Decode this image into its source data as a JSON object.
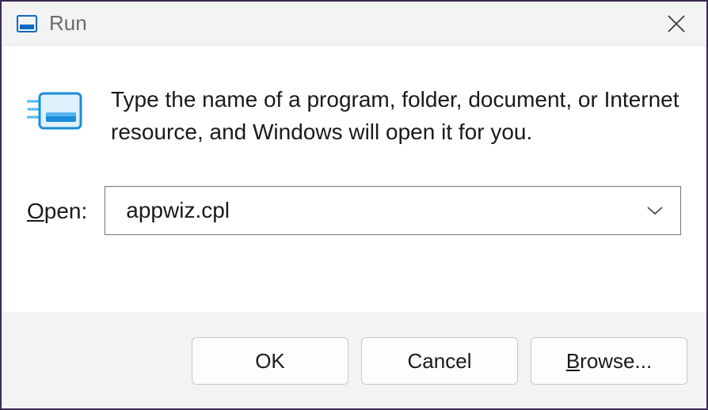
{
  "titlebar": {
    "title": "Run"
  },
  "content": {
    "description": "Type the name of a program, folder, document, or Internet resource, and Windows will open it for you.",
    "open_label_underline": "O",
    "open_label_rest": "pen:",
    "open_value": "appwiz.cpl"
  },
  "buttons": {
    "ok": "OK",
    "cancel": "Cancel",
    "browse_underline": "B",
    "browse_rest": "rowse..."
  }
}
